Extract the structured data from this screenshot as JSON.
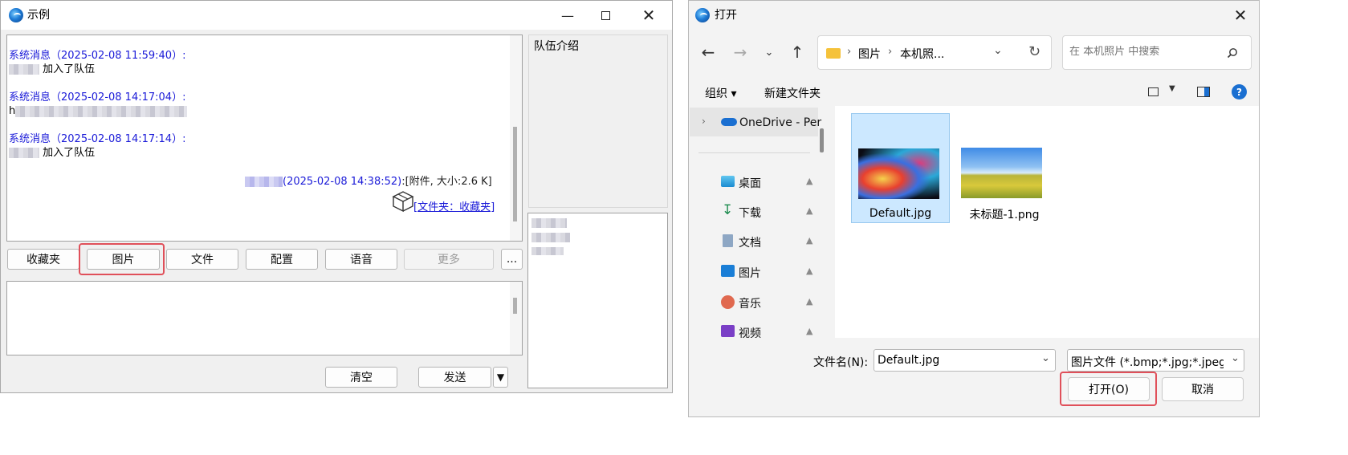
{
  "chat_window": {
    "title": "示例",
    "messages": [
      {
        "header": "系统消息（2025-02-08 11:59:40）:",
        "body": "加入了队伍"
      },
      {
        "header": "系统消息（2025-02-08 14:17:04）:",
        "body": "h"
      },
      {
        "header": "系统消息（2025-02-08 14:17:14）:",
        "body": "加入了队伍"
      }
    ],
    "attachment": {
      "time": "(2025-02-08 14:38:52)",
      "info": ":[附件, 大小:2.6 K]",
      "link": "[文件夹：收藏夹]"
    },
    "team_intro_label": "队伍介绍",
    "toolbar": {
      "favorites": "收藏夹",
      "image": "图片",
      "file": "文件",
      "config": "配置",
      "voice": "语音",
      "more": "更多",
      "ellipsis": "..."
    },
    "clear_label": "清空",
    "send_label": "发送",
    "send_dropdown": "▼"
  },
  "open_dialog": {
    "title": "打开",
    "breadcrumb": [
      "图片",
      "本机照..."
    ],
    "search_placeholder": "在 本机照片 中搜索",
    "organize_label": "组织 ▾",
    "new_folder_label": "新建文件夹",
    "nav": {
      "onedrive": "OneDrive - Per",
      "items": [
        {
          "label": "桌面",
          "icon": "desktop-icon"
        },
        {
          "label": "下载",
          "icon": "download-icon"
        },
        {
          "label": "文档",
          "icon": "document-icon"
        },
        {
          "label": "图片",
          "icon": "picture-icon"
        },
        {
          "label": "音乐",
          "icon": "music-icon"
        },
        {
          "label": "视频",
          "icon": "video-icon"
        }
      ]
    },
    "files": [
      {
        "name": "Default.jpg",
        "selected": true
      },
      {
        "name": "未标题-1.png",
        "selected": false
      }
    ],
    "filename_label": "文件名(N):",
    "filename_value": "Default.jpg",
    "filetype_value": "图片文件 (*.bmp;*.jpg;*.jpeg;*",
    "open_button": "打开(O)",
    "cancel_button": "取消",
    "colors": {
      "accent": "#1a6fd1",
      "selection": "#cce8ff",
      "highlight": "#e0505a",
      "link": "#1a1ad8"
    }
  }
}
